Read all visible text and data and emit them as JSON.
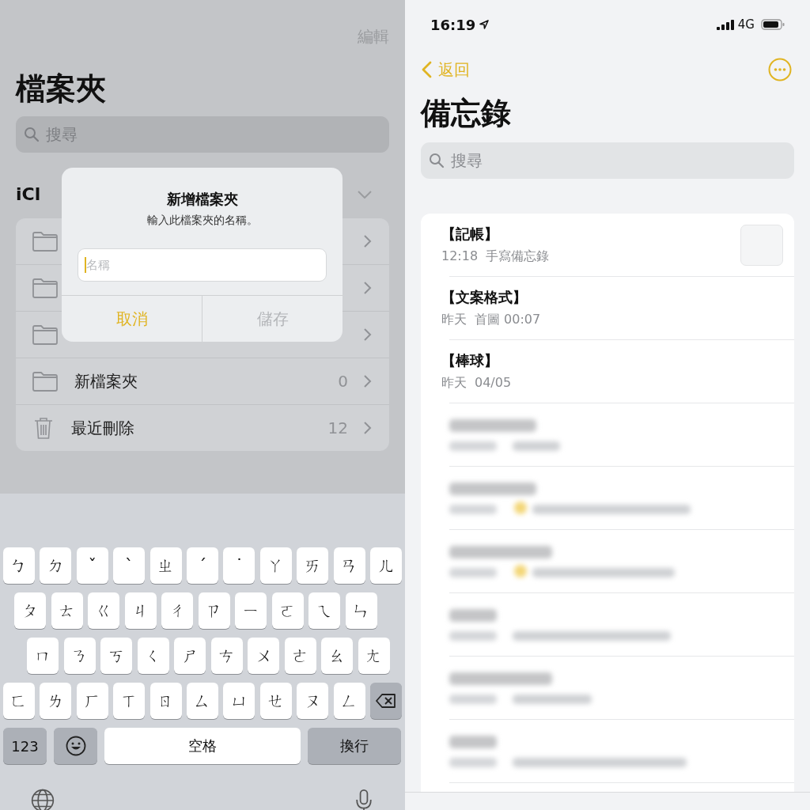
{
  "folders_screen": {
    "edit_button": "編輯",
    "title": "檔案夾",
    "search": {
      "placeholder": "搜尋"
    },
    "section_header": "iCl",
    "folders": [
      {
        "kind": "folder"
      },
      {
        "kind": "folder"
      },
      {
        "kind": "folder"
      },
      {
        "kind": "folder",
        "name": "新檔案夾",
        "count": "0"
      },
      {
        "kind": "trash",
        "name": "最近刪除",
        "count": "12"
      }
    ]
  },
  "dialog": {
    "title": "新增檔案夾",
    "message": "輸入此檔案夾的名稱。",
    "input": {
      "placeholder": "名稱"
    },
    "buttons": [
      {
        "label": "取消",
        "disabled": false
      },
      {
        "label": "儲存",
        "disabled": true
      }
    ]
  },
  "keyboard": {
    "rows": [
      [
        "ㄅ",
        "ㄉ",
        "ˇ",
        "ˋ",
        "ㄓ",
        "ˊ",
        "˙",
        "ㄚ",
        "ㄞ",
        "ㄢ",
        "ㄦ"
      ],
      [
        "ㄆ",
        "ㄊ",
        "ㄍ",
        "ㄐ",
        "ㄔ",
        "ㄗ",
        "ㄧ",
        "ㄛ",
        "ㄟ",
        "ㄣ"
      ],
      [
        "ㄇ",
        "ㄋ",
        "ㄎ",
        "ㄑ",
        "ㄕ",
        "ㄘ",
        "ㄨ",
        "ㄜ",
        "ㄠ",
        "ㄤ"
      ],
      [
        "ㄈ",
        "ㄌ",
        "ㄏ",
        "ㄒ",
        "ㄖ",
        "ㄙ",
        "ㄩ",
        "ㄝ",
        "ㄡ",
        "ㄥ"
      ]
    ],
    "numbers_key": "123",
    "space_key": "空格",
    "return_key": "換行"
  },
  "notes_screen": {
    "status_bar": {
      "time": "16:19",
      "network": "4G"
    },
    "back_button": "返回",
    "title": "備忘錄",
    "search": {
      "placeholder": "搜尋"
    },
    "notes": [
      {
        "kind": "note",
        "title": "【記帳】",
        "date": "12:18",
        "preview": "手寫備忘錄",
        "thumbnail": true
      },
      {
        "kind": "note",
        "title": "【文案格式】",
        "date": "昨天",
        "preview": "首圖 00:07"
      },
      {
        "kind": "note",
        "title": "【棒球】",
        "date": "昨天",
        "preview": "04/05"
      },
      {
        "kind": "blurred",
        "dot": false
      },
      {
        "kind": "blurred",
        "dot": true
      },
      {
        "kind": "blurred",
        "dot": true
      },
      {
        "kind": "blurred",
        "dot": false
      },
      {
        "kind": "blurred",
        "dot": false
      },
      {
        "kind": "blurred",
        "dot": false
      }
    ]
  }
}
